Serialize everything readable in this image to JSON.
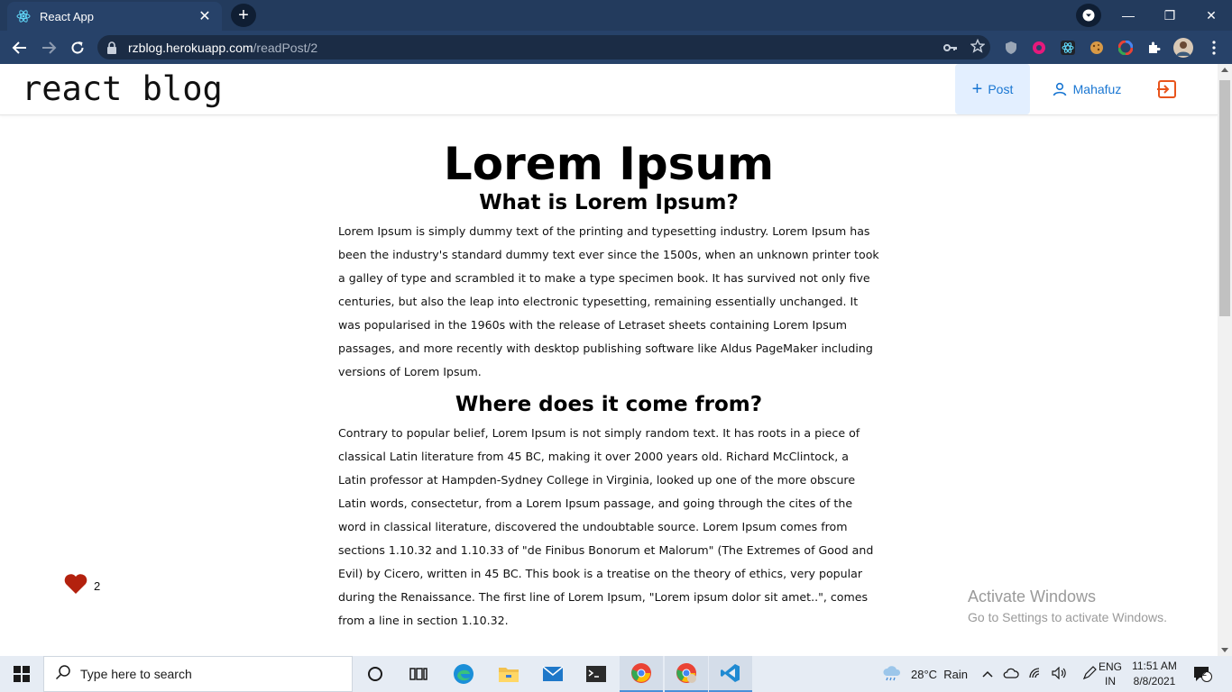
{
  "browser": {
    "tab_title": "React App",
    "url_host": "rzblog.herokuapp.com",
    "url_path": "/readPost/2"
  },
  "header": {
    "brand": "react blog",
    "post_label": "Post",
    "user_label": "Mahafuz"
  },
  "article": {
    "title": "Lorem Ipsum",
    "section1_heading": "What is Lorem Ipsum?",
    "section1_text": "Lorem Ipsum is simply dummy text of the printing and typesetting industry. Lorem Ipsum has been the industry's standard dummy text ever since the 1500s, when an unknown printer took a galley of type and scrambled it to make a type specimen book. It has survived not only five centuries, but also the leap into electronic typesetting, remaining essentially unchanged. It was popularised in the 1960s with the release of Letraset sheets containing Lorem Ipsum passages, and more recently with desktop publishing software like Aldus PageMaker including versions of Lorem Ipsum.",
    "section2_heading": "Where does it come from?",
    "section2_text": "Contrary to popular belief, Lorem Ipsum is not simply random text. It has roots in a piece of classical Latin literature from 45 BC, making it over 2000 years old. Richard McClintock, a Latin professor at Hampden-Sydney College in Virginia, looked up one of the more obscure Latin words, consectetur, from a Lorem Ipsum passage, and going through the cites of the word in classical literature, discovered the undoubtable source. Lorem Ipsum comes from sections 1.10.32 and 1.10.33 of \"de Finibus Bonorum et Malorum\" (The Extremes of Good and Evil) by Cicero, written in 45 BC. This book is a treatise on the theory of ethics, very popular during the Renaissance. The first line of Lorem Ipsum, \"Lorem ipsum dolor sit amet..\", comes from a line in section 1.10.32."
  },
  "like": {
    "count": "2",
    "color": "#b3210e"
  },
  "watermark": {
    "line1": "Activate Windows",
    "line2": "Go to Settings to activate Windows."
  },
  "taskbar": {
    "search_placeholder": "Type here to search",
    "weather": "28°C  Rain",
    "lang_top": "ENG",
    "lang_bottom": "IN",
    "time": "11:51 AM",
    "date": "8/8/2021",
    "notification_count": "2"
  },
  "colors": {
    "chrome_dark": "#233b5d",
    "accent_blue": "#1976d2",
    "logout_orange": "#e8541c"
  }
}
